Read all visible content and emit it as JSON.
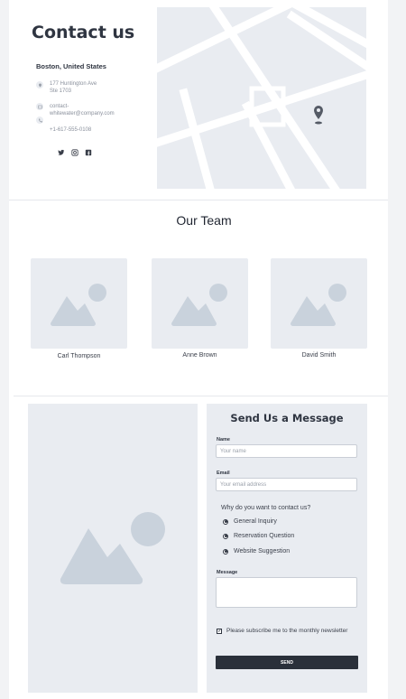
{
  "contact": {
    "title": "Contact us",
    "city": "Boston, United States",
    "address_line1": "177 Huntington Ave",
    "address_line2": "Ste 1703",
    "email_line1": "contact-",
    "email_line2": "whitewater@company.com",
    "phone": "+1-617-555-0108",
    "social": [
      {
        "icon": "twitter-icon",
        "glyph": "✨"
      },
      {
        "icon": "instagram-icon",
        "glyph": "◎"
      },
      {
        "icon": "facebook-icon",
        "glyph": "f"
      }
    ]
  },
  "team": {
    "title": "Our Team",
    "members": [
      {
        "name": "Carl Thompson"
      },
      {
        "name": "Anne Brown"
      },
      {
        "name": "David Smith"
      }
    ]
  },
  "form": {
    "title": "Send Us a Message",
    "name_label": "Name",
    "name_placeholder": "Your name",
    "email_label": "Email",
    "email_placeholder": "Your email address",
    "reason_question": "Why do you want to contact us?",
    "reasons": [
      "General Inquiry",
      "Reservation Question",
      "Website Suggestion"
    ],
    "message_label": "Message",
    "subscribe_label": "Please subscribe me to the monthly newsletter",
    "send_label": "SEND"
  },
  "colors": {
    "placeholder": "#e9ecf1",
    "placeholder_shape": "#c9d2dc",
    "dark": "#2a303a"
  }
}
